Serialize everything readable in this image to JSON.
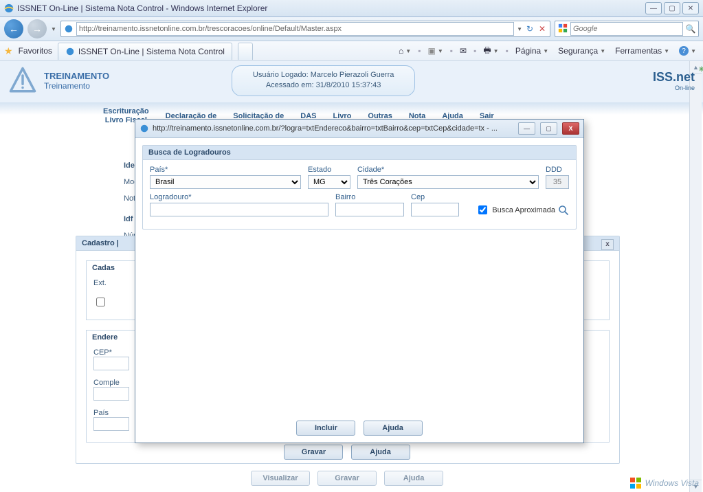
{
  "ie": {
    "window_title": "ISSNET On-Line | Sistema Nota Control - Windows Internet Explorer",
    "url": "http://treinamento.issnetonline.com.br/trescoracoes/online/Default/Master.aspx",
    "search_placeholder": "Google",
    "favorites_label": "Favoritos",
    "tab_title": "ISSNET On-Line | Sistema Nota Control",
    "cmd": {
      "pagina": "Página",
      "seguranca": "Segurança",
      "ferramentas": "Ferramentas"
    }
  },
  "hdr": {
    "line1": "TREINAMENTO",
    "line2": "Treinamento",
    "user_line1": "Usuário Logado: Marcelo Pierazoli Guerra",
    "user_line2": "Acessado em: 31/8/2010 15:37:43",
    "logo_text": "ISS.net",
    "logo_sub": "On-line"
  },
  "tabs": {
    "t1a": "Escrituração",
    "t1b": "Livro Fiscal",
    "t2": "Declaração de",
    "t3": "Solicitação de",
    "t4": "DAS",
    "t5": "Livro",
    "t6": "Outras",
    "t7": "Nota",
    "t8": "Ajuda",
    "t9": "Sair"
  },
  "bg": {
    "iden_title": "Iden",
    "mod": "Moc",
    "not": "Not",
    "idf_title": "Idf",
    "num": "Núm",
    "cadastro_title": "Cadastro |",
    "cadas_title": "Cadas",
    "ext": "Ext.",
    "endere_title": "Endere",
    "cep": "CEP*",
    "compl": "Comple",
    "pais": "País",
    "btn_gravar": "Gravar",
    "btn_ajuda": "Ajuda",
    "btn_visualizar": "Visualizar",
    "btn_gravar2": "Gravar",
    "btn_ajuda2": "Ajuda"
  },
  "popup": {
    "window_title": "http://treinamento.issnetonline.com.br/?logra=txtEndereco&bairro=txtBairro&cep=txtCep&cidade=tx - ...",
    "panel_title": "Busca de Logradouros",
    "lbl_pais": "País*",
    "lbl_estado": "Estado",
    "lbl_cidade": "Cidade*",
    "lbl_ddd": "DDD",
    "val_pais": "Brasil",
    "val_estado": "MG",
    "val_cidade": "Três Corações",
    "val_ddd": "35",
    "lbl_logradouro": "Logradouro*",
    "lbl_bairro": "Bairro",
    "lbl_cep": "Cep",
    "chk_busca": "Busca Aproximada",
    "btn_incluir": "Incluir",
    "btn_ajuda": "Ajuda"
  },
  "vista": "Windows Vista"
}
